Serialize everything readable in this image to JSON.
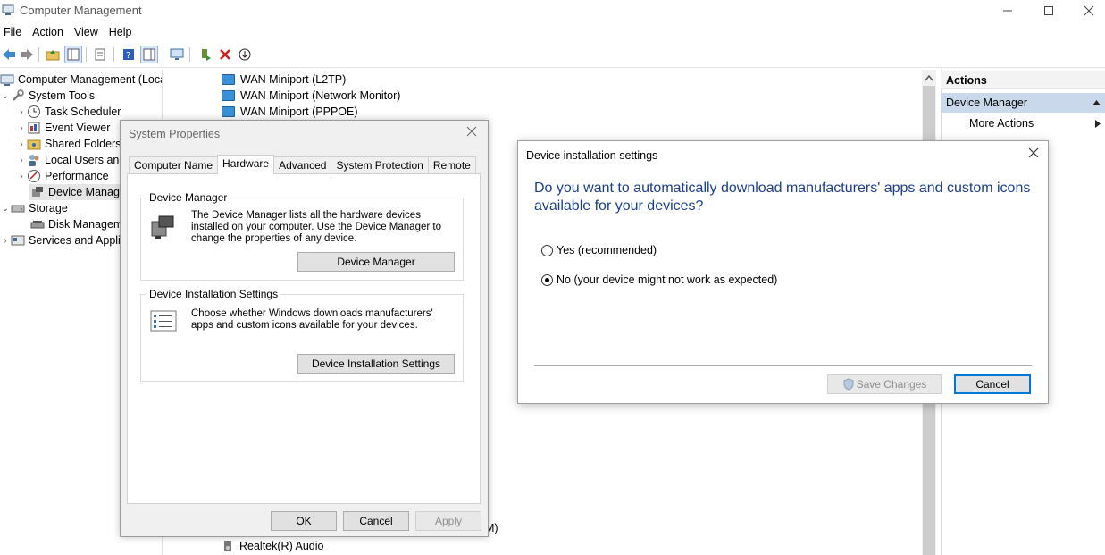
{
  "window": {
    "title": "Computer Management",
    "minimize_icon": "minimize-icon",
    "maximize_icon": "maximize-icon",
    "close_icon": "close-icon"
  },
  "menu": [
    "File",
    "Action",
    "View",
    "Help"
  ],
  "tree": {
    "items": [
      {
        "label": "Computer Management (Local",
        "indent": 0,
        "arrow": ""
      },
      {
        "label": "System Tools",
        "indent": 1,
        "arrow": "down"
      },
      {
        "label": "Task Scheduler",
        "indent": 2,
        "arrow": "right"
      },
      {
        "label": "Event Viewer",
        "indent": 2,
        "arrow": "right"
      },
      {
        "label": "Shared Folders",
        "indent": 2,
        "arrow": "right"
      },
      {
        "label": "Local Users and",
        "indent": 2,
        "arrow": "right"
      },
      {
        "label": "Performance",
        "indent": 2,
        "arrow": "right"
      },
      {
        "label": "Device Manager",
        "indent": 2,
        "arrow": "",
        "selected": true
      },
      {
        "label": "Storage",
        "indent": 1,
        "arrow": "down"
      },
      {
        "label": "Disk Managem",
        "indent": 2,
        "arrow": ""
      },
      {
        "label": "Services and Appli",
        "indent": 1,
        "arrow": "right"
      }
    ]
  },
  "devices": {
    "top": [
      "WAN Miniport (L2TP)",
      "WAN Miniport (Network Monitor)",
      "WAN Miniport (PPPOE)"
    ],
    "bottom_fragment": "M)",
    "bottom": "Realtek(R) Audio"
  },
  "actions": {
    "header": "Actions",
    "selected": "Device Manager",
    "more": "More Actions"
  },
  "sysprops": {
    "title": "System Properties",
    "tabs": [
      "Computer Name",
      "Hardware",
      "Advanced",
      "System Protection",
      "Remote"
    ],
    "active_tab": "Hardware",
    "dm_group": {
      "title": "Device Manager",
      "text": "The Device Manager lists all the hardware devices installed on your computer. Use the Device Manager to change the properties of any device.",
      "button": "Device Manager"
    },
    "dis_group": {
      "title": "Device Installation Settings",
      "text": "Choose whether Windows downloads manufacturers' apps and custom icons available for your devices.",
      "button": "Device Installation Settings"
    },
    "ok": "OK",
    "cancel": "Cancel",
    "apply": "Apply"
  },
  "devinst": {
    "title": "Device installation settings",
    "question": "Do you want to automatically download manufacturers' apps and custom icons available for your devices?",
    "option_yes": "Yes (recommended)",
    "option_no": "No (your device might not work as expected)",
    "selected_option": "no",
    "save": "Save Changes",
    "cancel": "Cancel"
  },
  "colors": {
    "question_text": "#1a3f8a",
    "selection_bg": "#c9d8eb",
    "focus_border": "#0078d7"
  }
}
